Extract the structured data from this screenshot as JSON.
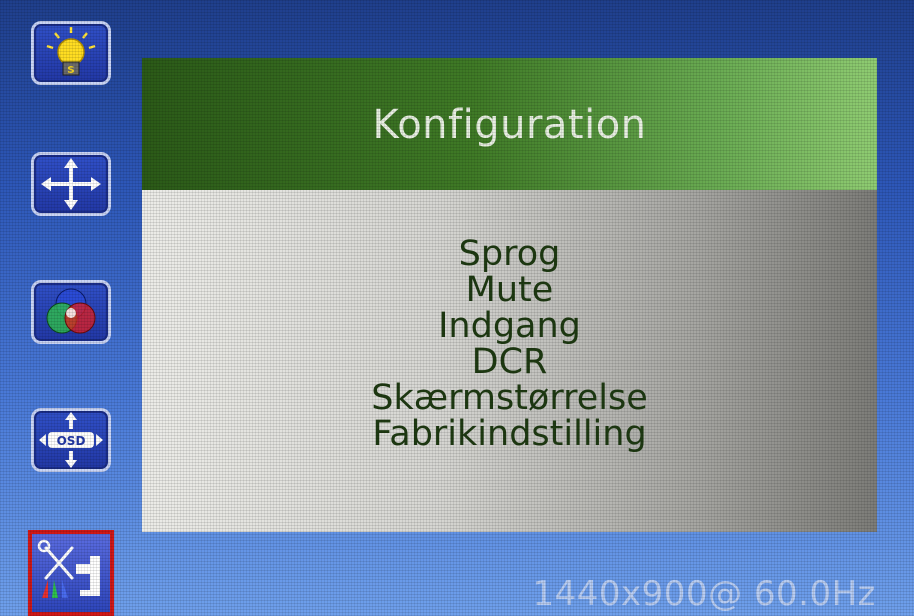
{
  "sidebar": {
    "icons": [
      {
        "name": "brightness-icon",
        "selected": false
      },
      {
        "name": "position-icon",
        "selected": false
      },
      {
        "name": "color-icon",
        "selected": false
      },
      {
        "name": "osd-position-icon",
        "selected": false
      },
      {
        "name": "configuration-icon",
        "selected": true
      }
    ]
  },
  "menu": {
    "title": "Konfiguration",
    "items": [
      "Sprog",
      "Mute",
      "Indgang",
      "DCR",
      "Skærmstørrelse",
      "Fabrikindstilling"
    ]
  },
  "status": {
    "resolution": "1440x900@ 60.0Hz"
  },
  "colors": {
    "background": "#2d57b8",
    "header_green": "#3f7a26",
    "body_gray": "#d6d6d2",
    "item_text": "#1e3a12",
    "selection_border": "#d01818"
  }
}
